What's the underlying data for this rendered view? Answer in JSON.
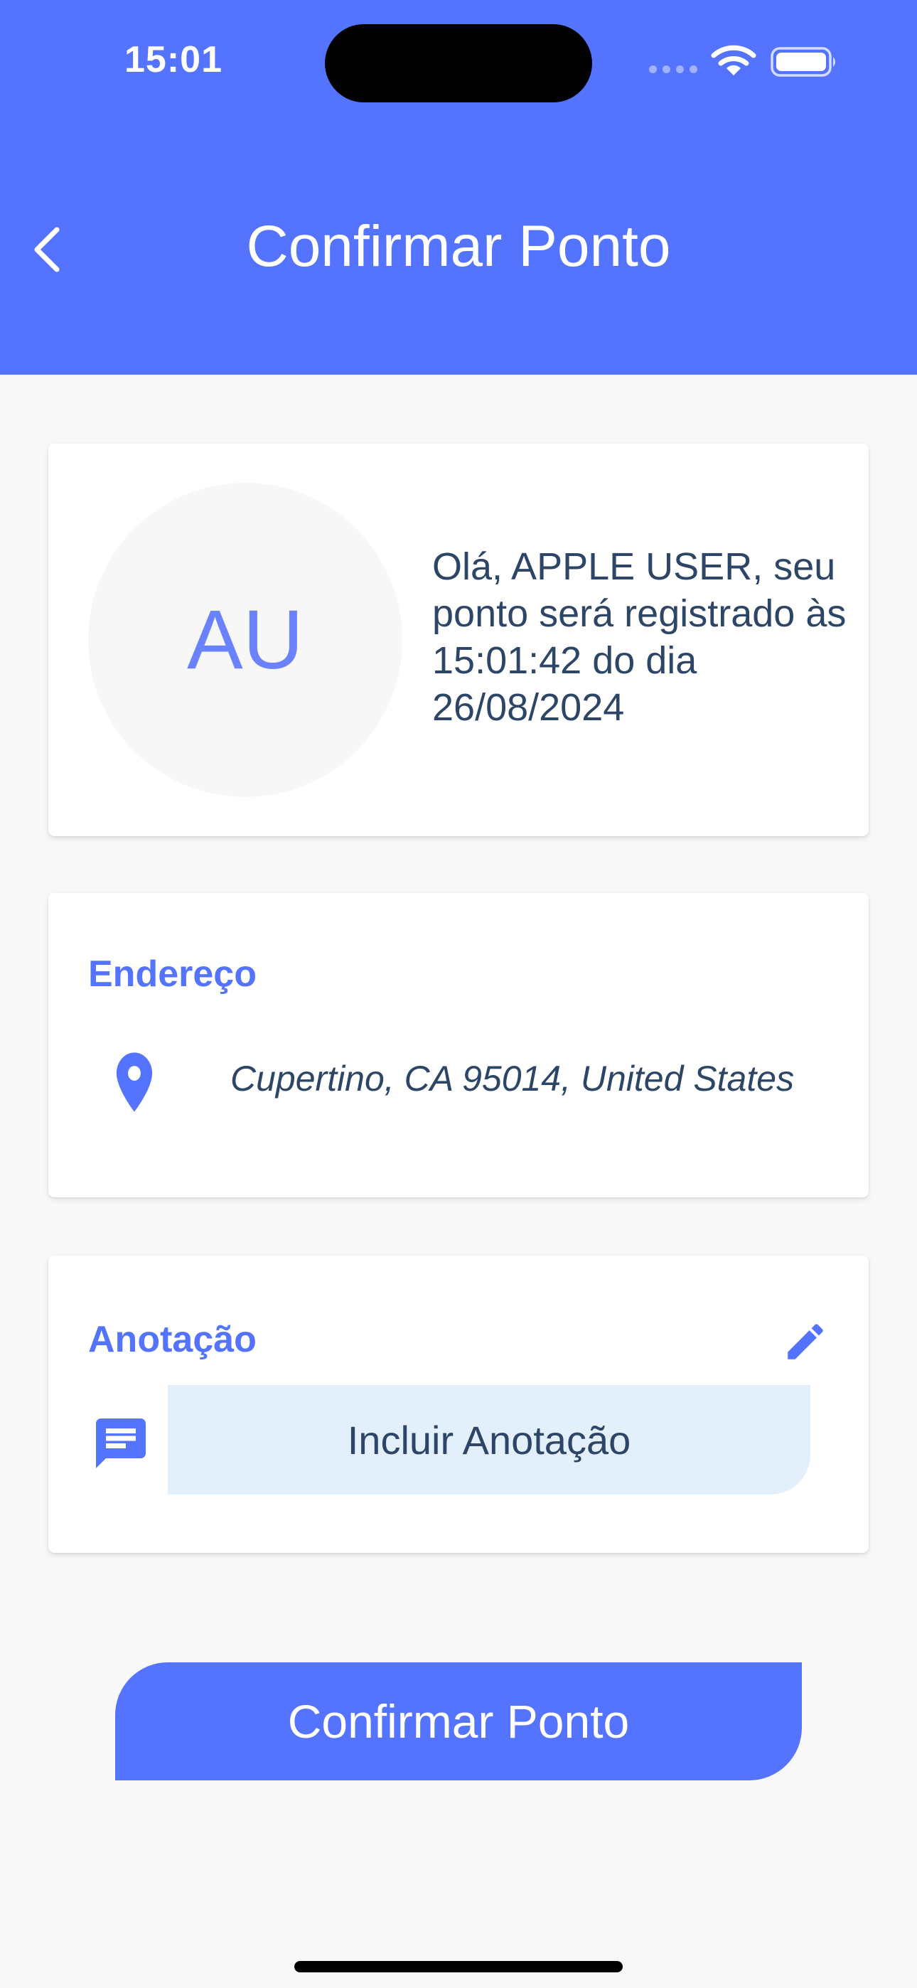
{
  "status_bar": {
    "time": "15:01",
    "icons": [
      "signal-dots-icon",
      "wifi-icon",
      "battery-icon"
    ]
  },
  "header": {
    "back_icon": "chevron-left-icon",
    "title": "Confirmar Ponto"
  },
  "user_card": {
    "initials": "AU",
    "greeting": "Olá, APPLE USER, seu ponto será registrado às 15:01:42 do dia 26/08/2024"
  },
  "address_card": {
    "title": "Endereço",
    "icon": "location-pin-icon",
    "address": "Cupertino, CA 95014, United States"
  },
  "note_card": {
    "title": "Anotação",
    "edit_icon": "pencil-icon",
    "message_icon": "chat-icon",
    "include_label": "Incluir Anotação"
  },
  "confirm_button": {
    "label": "Confirmar Ponto"
  },
  "colors": {
    "primary": "#5473ff",
    "text_dark": "#2d4566",
    "note_field": "#e3f0fc",
    "background": "#f8f8f8"
  }
}
